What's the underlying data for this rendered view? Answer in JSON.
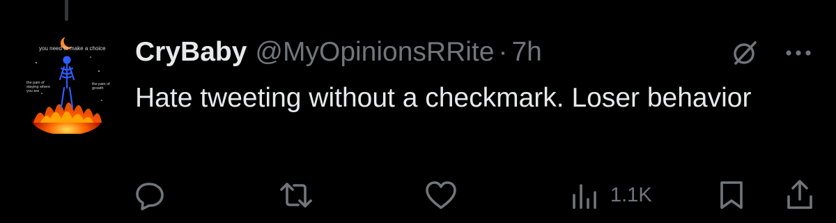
{
  "tweet": {
    "display_name": "CryBaby",
    "handle": "@MyOpinionsRRite",
    "separator": "·",
    "time": "7h",
    "text": "Hate tweeting without a checkmark. Loser behavior"
  },
  "avatar": {
    "title": "you need to make a choice",
    "left_caption": "the pain of staying where you are",
    "right_caption": "the pain of growth"
  },
  "actions": {
    "views_count": "1.1K"
  },
  "icons": {
    "grok": "grok-slash-circle-icon",
    "more": "more-dots-icon",
    "reply": "reply-bubble-icon",
    "retweet": "retweet-arrows-icon",
    "like": "heart-icon",
    "views": "views-bars-icon",
    "bookmark": "bookmark-icon",
    "share": "share-upload-icon"
  },
  "colors": {
    "background": "#000000",
    "primary_text": "#e7e9ea",
    "secondary_text": "#71767b",
    "thread_line": "#333639"
  }
}
